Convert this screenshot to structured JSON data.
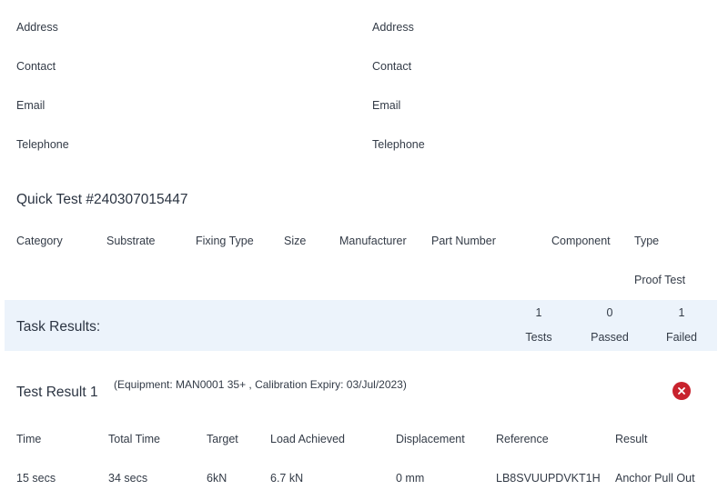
{
  "contact_left": {
    "address": "Address",
    "contact": "Contact",
    "email": "Email",
    "telephone": "Telephone"
  },
  "contact_right": {
    "address": "Address",
    "contact": "Contact",
    "email": "Email",
    "telephone": "Telephone"
  },
  "quick_test": {
    "title": "Quick Test #240307015447",
    "columns": [
      "Category",
      "Substrate",
      "Fixing Type",
      "Size",
      "Manufacturer",
      "Part Number",
      "Component",
      "Type"
    ],
    "type_value": "Proof Test"
  },
  "task_results": {
    "label": "Task Results:",
    "tests_count": "1",
    "tests_label": "Tests",
    "passed_count": "0",
    "passed_label": "Passed",
    "failed_count": "1",
    "failed_label": "Failed"
  },
  "test_result": {
    "title": "Test Result 1",
    "equipment": "(Equipment: MAN0001 35+ , Calibration Expiry: 03/Jul/2023)",
    "status_icon": "close-circle-icon",
    "status_color": "#c8222d",
    "columns": [
      "Time",
      "Total Time",
      "Target",
      "Load Achieved",
      "Displacement",
      "Reference",
      "Result"
    ],
    "row": [
      "15 secs",
      "34 secs",
      "6kN",
      "6.7 kN",
      "0 mm",
      "LB8SVUUPDVKT1H",
      "Anchor Pull Out"
    ]
  }
}
